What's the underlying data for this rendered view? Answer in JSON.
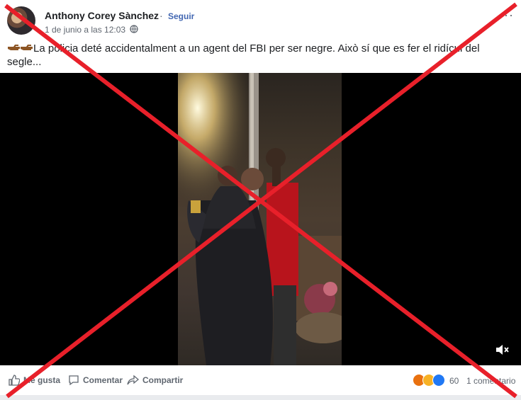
{
  "post": {
    "author": "Anthony Corey Sànchez",
    "separator": "·",
    "follow_label": "Seguir",
    "timestamp": "1 de junio a las 12:03",
    "privacy_icon": "globe-icon",
    "more_icon": "more-options-icon",
    "text": "La policia deté accidentalment a un agent del FBI per ser negre. Això sí que es fer el ridícul del segle..."
  },
  "video": {
    "volume_icon": "muted-volume-icon"
  },
  "actions": {
    "like_label": "Me gusta",
    "comment_label": "Comentar",
    "share_label": "Compartir",
    "reactions": [
      "angry",
      "haha",
      "like"
    ],
    "reaction_count": "60",
    "comments_count": "1 comentario"
  },
  "overlay": {
    "x_color": "#e8202a"
  }
}
